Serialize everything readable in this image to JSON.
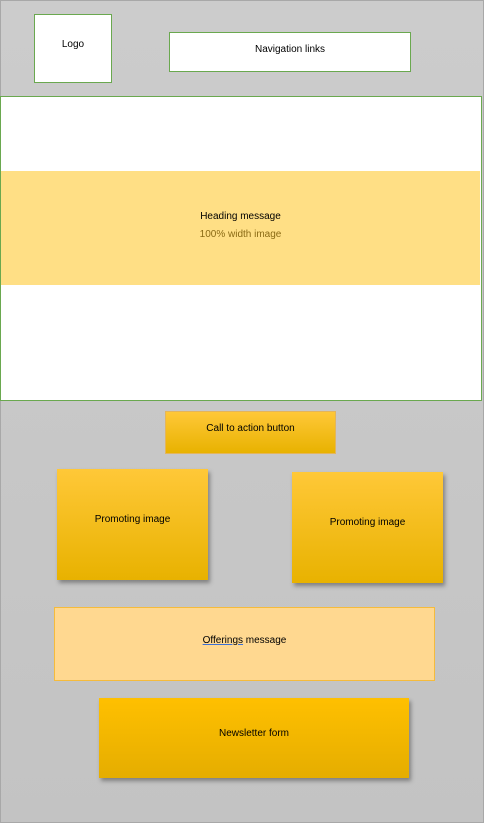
{
  "header": {
    "logo_label": "Logo",
    "nav_label": "Navigation links"
  },
  "hero": {
    "heading": "Heading message",
    "subtext": "100% width image"
  },
  "cta": {
    "label": "Call to action button"
  },
  "promos": [
    {
      "label": "Promoting image"
    },
    {
      "label": "Promoting image"
    }
  ],
  "offerings": {
    "word": "Offerings",
    "rest": " message"
  },
  "newsletter": {
    "label": "Newsletter form"
  },
  "colors": {
    "page_background": "#c4c4c4",
    "frame_border": "#6aa84f",
    "hero_band": "#ffdf85",
    "gold": "#ffc000",
    "offer_fill": "#ffd890"
  }
}
